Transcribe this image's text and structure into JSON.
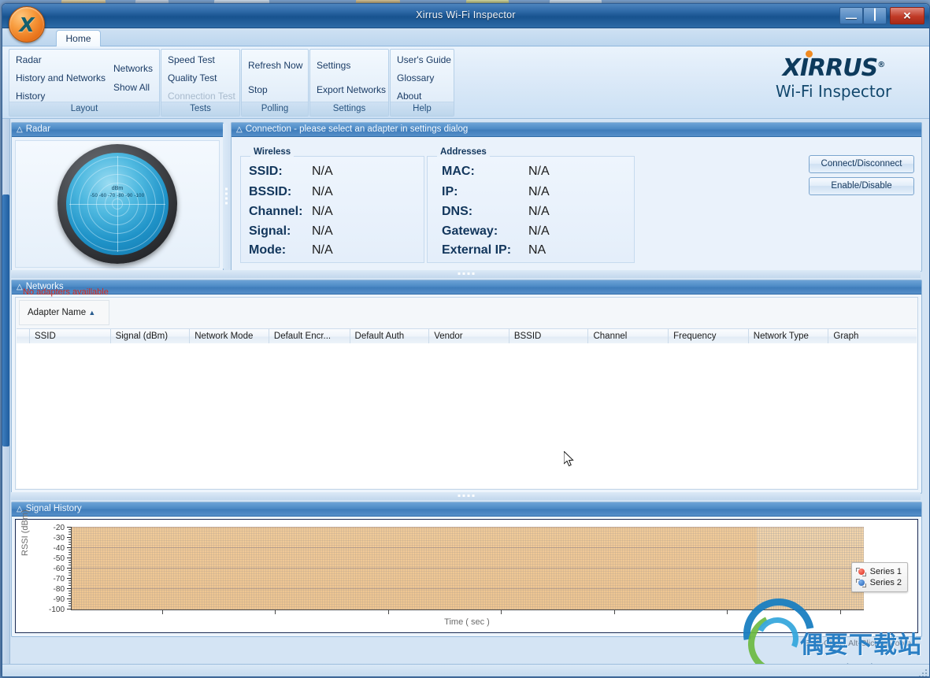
{
  "window": {
    "title": "Xirrus Wi-Fi Inspector",
    "app_icon": "xirrus-x-orb-icon",
    "controls": {
      "minimize": "minimize-icon",
      "maximize": "maximize-icon",
      "close": "close-icon"
    }
  },
  "tabs": [
    {
      "label": "Home",
      "active": true
    }
  ],
  "ribbon": {
    "groups": [
      {
        "name": "Layout",
        "label": "Layout",
        "items": [
          {
            "label": "Radar",
            "disabled": false
          },
          {
            "label": "History and Networks",
            "disabled": false
          },
          {
            "label": "History",
            "disabled": false
          },
          {
            "label": "Networks",
            "disabled": false
          },
          {
            "label": "Show All",
            "disabled": false
          }
        ]
      },
      {
        "name": "Tests",
        "label": "Tests",
        "items": [
          {
            "label": "Speed Test",
            "disabled": false
          },
          {
            "label": "Quality Test",
            "disabled": false
          },
          {
            "label": "Connection Test",
            "disabled": true
          }
        ]
      },
      {
        "name": "Polling",
        "label": "Polling",
        "items": [
          {
            "label": "Refresh Now",
            "disabled": false
          },
          {
            "label": "Stop",
            "disabled": false
          }
        ]
      },
      {
        "name": "Settings",
        "label": "Settings",
        "items": [
          {
            "label": "Settings",
            "disabled": false
          },
          {
            "label": "Export Networks",
            "disabled": false
          }
        ]
      },
      {
        "name": "Help",
        "label": "Help",
        "items": [
          {
            "label": "User's Guide",
            "disabled": false
          },
          {
            "label": "Glossary",
            "disabled": false
          },
          {
            "label": "About",
            "disabled": false
          }
        ]
      }
    ]
  },
  "logo": {
    "brand": "XIRRUS",
    "registered": "®",
    "subtitle": "Wi-Fi Inspector",
    "brand_color": "#0d3a5c",
    "dot_color": "#f08a21"
  },
  "radar_panel": {
    "title": "Radar",
    "unit_label": "dBm",
    "scale_labels": "-50 -60 -70 -80 -90 -100",
    "scale_values": [
      -50,
      -60,
      -70,
      -80,
      -90,
      -100
    ]
  },
  "connection_panel": {
    "title": "Connection - please select an adapter in settings dialog",
    "wireless": {
      "heading": "Wireless",
      "rows": [
        {
          "label": "SSID:",
          "value": "N/A"
        },
        {
          "label": "BSSID:",
          "value": "N/A"
        },
        {
          "label": "Channel:",
          "value": "N/A"
        },
        {
          "label": "Signal:",
          "value": "N/A"
        },
        {
          "label": "Mode:",
          "value": "N/A"
        }
      ]
    },
    "addresses": {
      "heading": "Addresses",
      "rows": [
        {
          "label": "MAC:",
          "value": "N/A"
        },
        {
          "label": "IP:",
          "value": "N/A"
        },
        {
          "label": "DNS:",
          "value": "N/A"
        },
        {
          "label": "Gateway:",
          "value": "N/A"
        },
        {
          "label": "External IP:",
          "value": "NA"
        }
      ]
    },
    "buttons": [
      {
        "label": "Connect/Disconnect"
      },
      {
        "label": "Enable/Disable"
      }
    ]
  },
  "networks_panel": {
    "title": "Networks",
    "warning": "No adapters availlable",
    "warning_color": "#d42b1f",
    "adapter_selector": {
      "label": "Adapter Name",
      "sort_glyph": "▲"
    },
    "columns": [
      {
        "label": "",
        "width": 17
      },
      {
        "label": "SSID",
        "width": 103
      },
      {
        "label": "Signal (dBm)",
        "width": 101
      },
      {
        "label": "Network Mode",
        "width": 101
      },
      {
        "label": "Default Encr...",
        "width": 103
      },
      {
        "label": "Default Auth",
        "width": 101
      },
      {
        "label": "Vendor",
        "width": 102
      },
      {
        "label": "BSSID",
        "width": 101
      },
      {
        "label": "Channel",
        "width": 102
      },
      {
        "label": "Frequency",
        "width": 102
      },
      {
        "label": "Network Type",
        "width": 102
      },
      {
        "label": "Graph",
        "width": 112
      }
    ],
    "rows": []
  },
  "signal_history_panel": {
    "title": "Signal History",
    "zoom_hint": "Shift-Click / Alt-Click to Zoom"
  },
  "chart_data": {
    "type": "line",
    "title": "Signal History",
    "xlabel": "Time ( sec )",
    "ylabel": "RSSI (dBm)",
    "ylim": [
      -100,
      -20
    ],
    "yticks": [
      -20,
      -30,
      -40,
      -50,
      -60,
      -70,
      -80,
      -90,
      -100
    ],
    "xticks": [],
    "grid": true,
    "legend_position": "right",
    "series": [
      {
        "name": "Series 1",
        "color": "#e03a2f",
        "values": []
      },
      {
        "name": "Series 2",
        "color": "#2d6fc4",
        "values": []
      }
    ]
  },
  "watermark": {
    "chinese": "偶要下载站",
    "domain": "ouyaoxiazai.com"
  }
}
